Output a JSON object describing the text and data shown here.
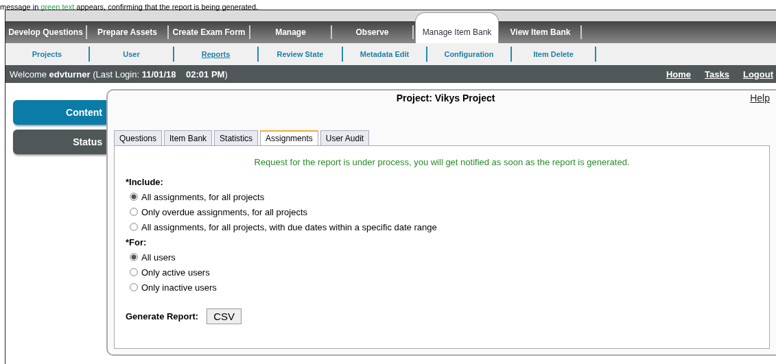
{
  "caption": [
    {
      "text": "message in ",
      "kind": "plain"
    },
    {
      "text": "green text",
      "kind": "green"
    },
    {
      "text": " appears, confirming that the report is being generated.",
      "kind": "plain"
    }
  ],
  "main_nav": [
    {
      "label": "Develop Questions",
      "selected": false
    },
    {
      "label": "Prepare Assets",
      "selected": false
    },
    {
      "label": "Create Exam Form",
      "selected": false
    },
    {
      "label": "Manage",
      "selected": false
    },
    {
      "label": "Observe",
      "selected": false
    },
    {
      "label": "Manage Item Bank",
      "selected": true
    },
    {
      "label": "View Item Bank",
      "selected": false
    }
  ],
  "sub_nav": [
    {
      "label": "Projects",
      "selected": false
    },
    {
      "label": "User",
      "selected": false
    },
    {
      "label": "Reports",
      "selected": true
    },
    {
      "label": "Review State",
      "selected": false
    },
    {
      "label": "Metadata Edit",
      "selected": false
    },
    {
      "label": "Configuration",
      "selected": false
    },
    {
      "label": "Item Delete",
      "selected": false
    }
  ],
  "welcome": {
    "prefix": "Welcome ",
    "user": "edvturner",
    "login_label": " (Last Login: ",
    "date": "11/01/18",
    "time": "02:01 PM",
    "suffix": ")"
  },
  "header_links": [
    "Home",
    "Tasks",
    "Logout"
  ],
  "sidebar": [
    {
      "label": "Content",
      "selected": true
    },
    {
      "label": "Status",
      "selected": false
    }
  ],
  "panel": {
    "title": "Project: Vikys Project",
    "help": "Help",
    "tabs": [
      {
        "label": "Questions",
        "selected": false
      },
      {
        "label": "Item Bank",
        "selected": false
      },
      {
        "label": "Statistics",
        "selected": false
      },
      {
        "label": "Assignments",
        "selected": true
      },
      {
        "label": "User Audit",
        "selected": false
      }
    ],
    "message": "Request for the report is under process, you will get notified as soon as the report is generated.",
    "groups": [
      {
        "label": "*Include:",
        "options": [
          {
            "label": "All assignments, for all projects",
            "selected": true
          },
          {
            "label": "Only overdue assignments, for all projects",
            "selected": false
          },
          {
            "label": "All assignments, for all projects, with due dates within a specific date range",
            "selected": false
          }
        ]
      },
      {
        "label": "*For:",
        "options": [
          {
            "label": "All users",
            "selected": true
          },
          {
            "label": "Only active users",
            "selected": false
          },
          {
            "label": "Only inactive users",
            "selected": false
          }
        ]
      }
    ],
    "generate_label": "Generate Report:",
    "generate_button": "CSV"
  }
}
